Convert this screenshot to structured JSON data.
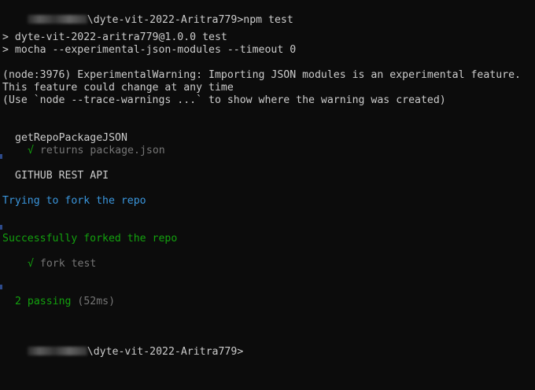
{
  "prompt1": {
    "path_suffix": "\\dyte-vit-2022-Aritra779>",
    "command": "npm test"
  },
  "npm_header": [
    "> dyte-vit-2022-aritra779@1.0.0 test",
    "> mocha --experimental-json-modules --timeout 0"
  ],
  "warning": [
    "(node:3976) ExperimentalWarning: Importing JSON modules is an experimental feature.",
    "This feature could change at any time",
    "(Use `node --trace-warnings ...` to show where the warning was created)"
  ],
  "suite1": {
    "title": "getRepoPackageJSON",
    "check": "√",
    "test": "returns package.json"
  },
  "suite2": {
    "title": "GITHUB REST API"
  },
  "logs": {
    "trying": "Trying to fork the repo",
    "success": "Successfully forked the repo"
  },
  "suite2_test": {
    "check": "√",
    "test": "fork test"
  },
  "summary": {
    "passing": "2 passing",
    "duration": "(52ms)"
  },
  "prompt2": {
    "path_suffix": "\\dyte-vit-2022-Aritra779>"
  },
  "colors": {
    "background": "#0c0c0c",
    "text": "#cccccc",
    "dim": "#767676",
    "green": "#13a10e",
    "blue": "#3a96dd"
  }
}
